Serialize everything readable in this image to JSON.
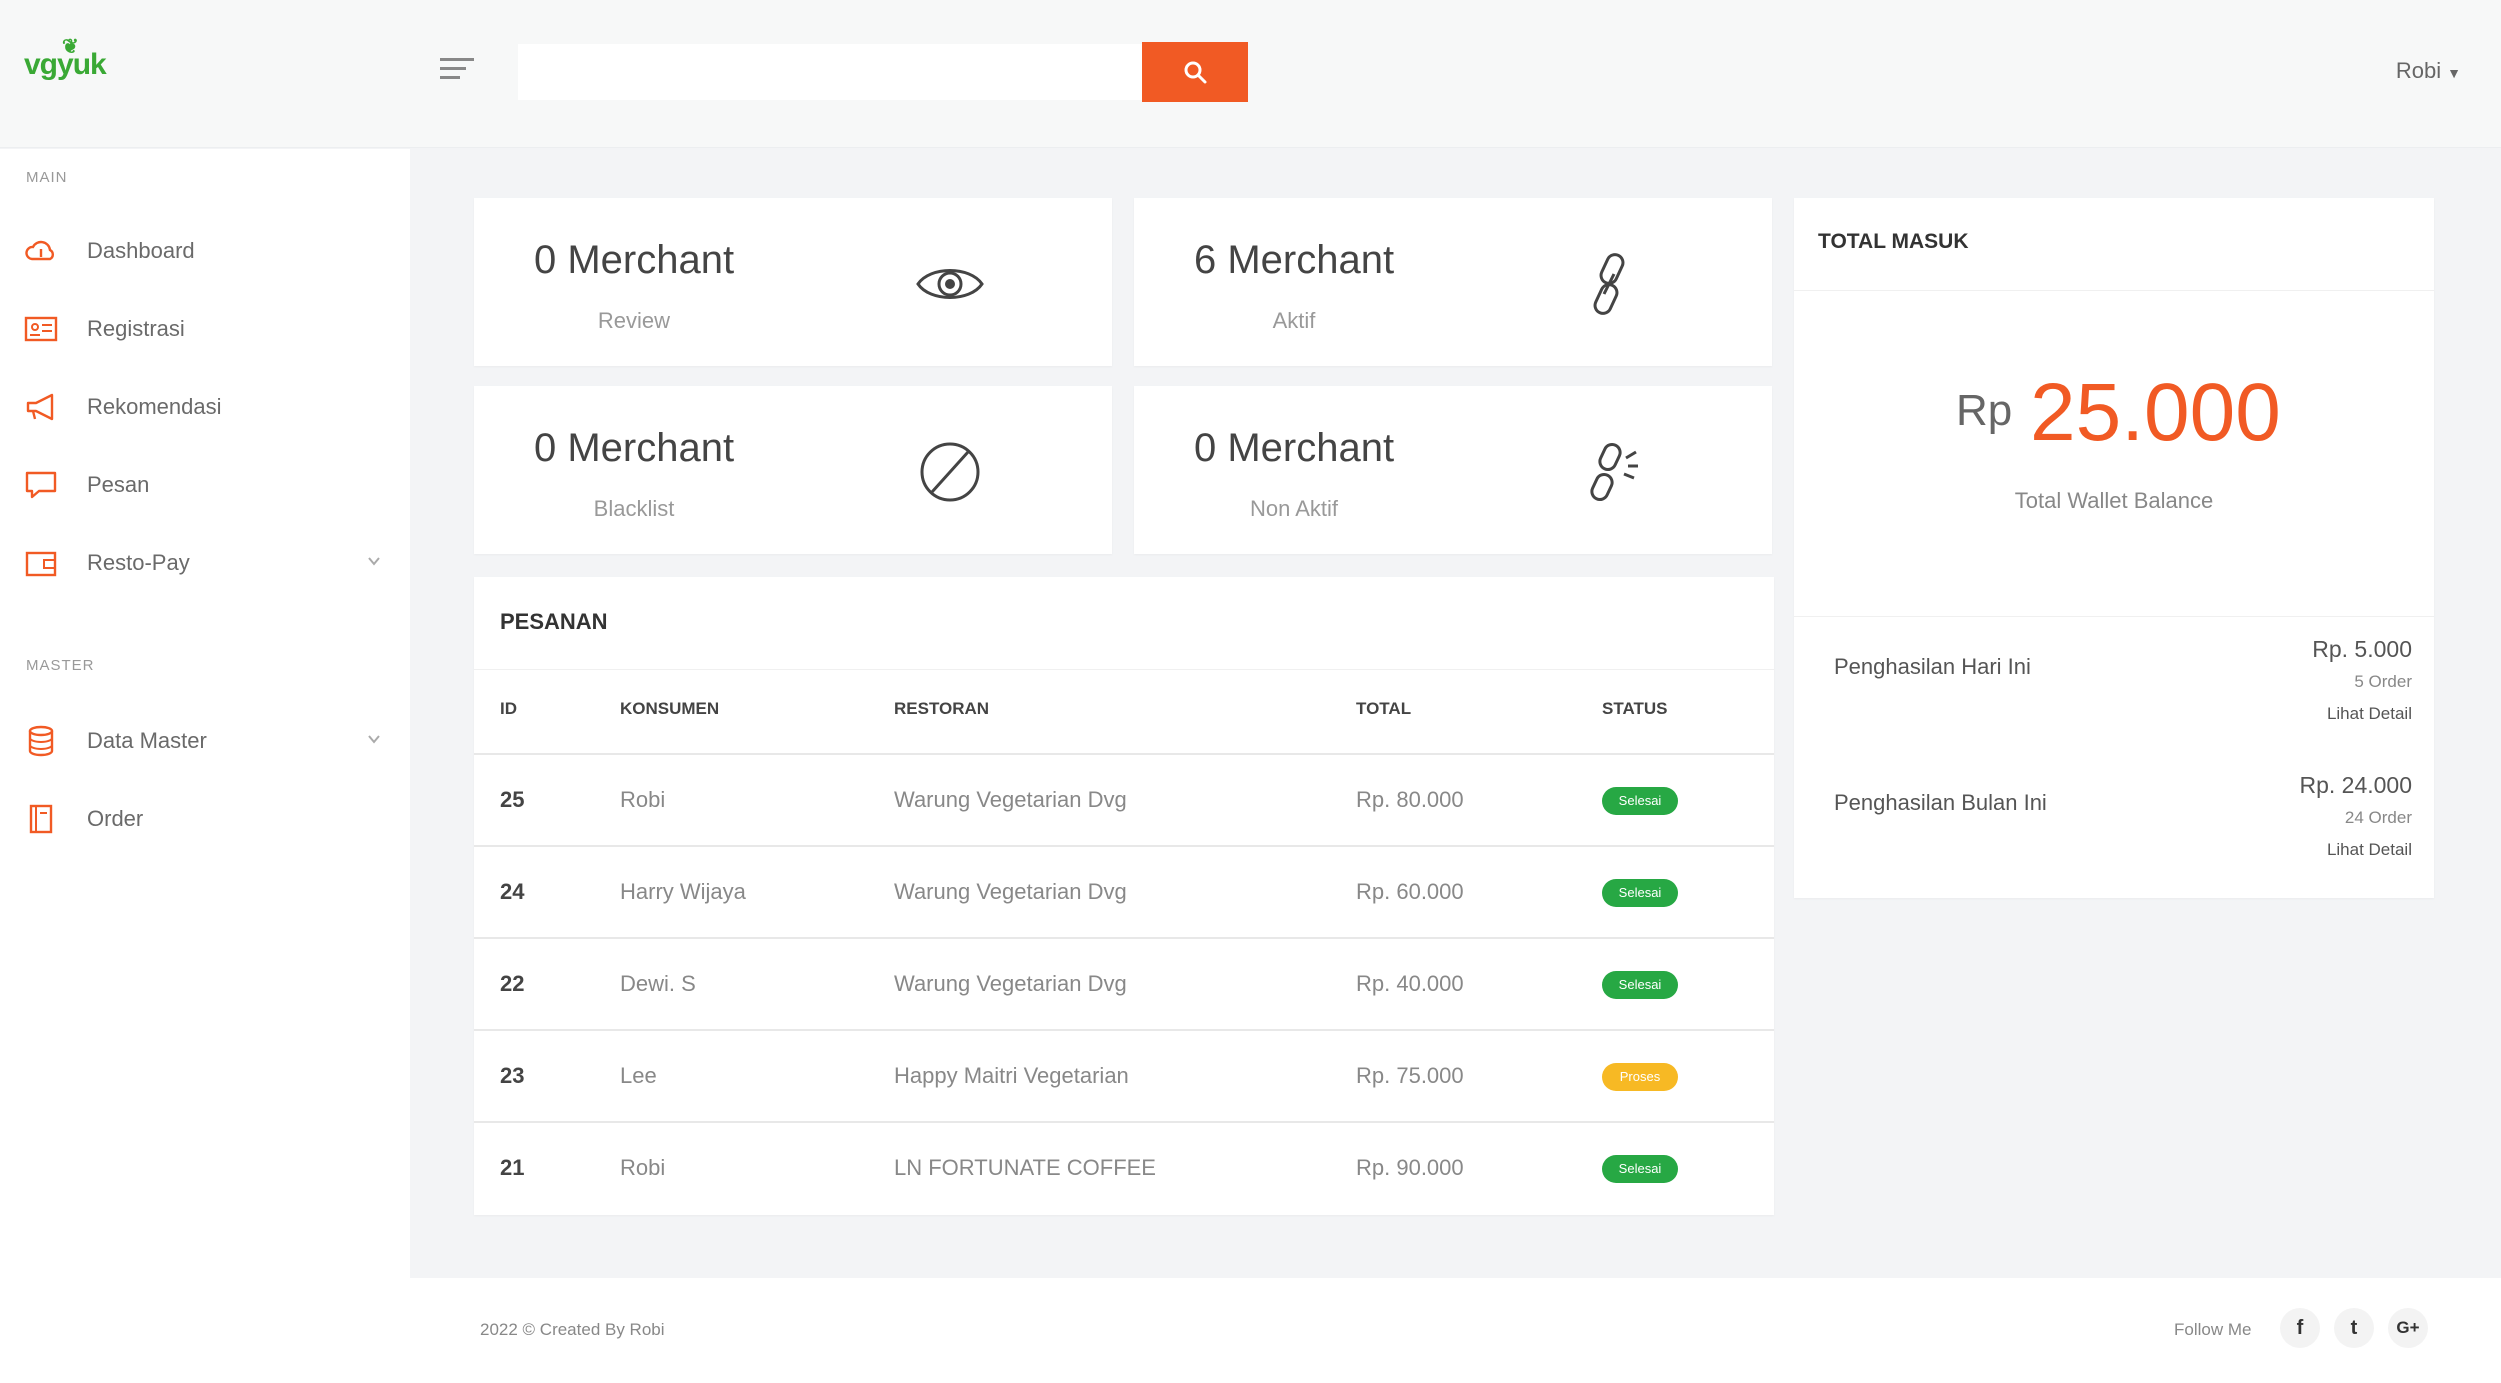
{
  "brand": {
    "logo": "vgyuk",
    "color_primary": "#f15a24",
    "color_logo": "#3aa935"
  },
  "header": {
    "search_placeholder": "",
    "user_name": "Robi"
  },
  "sidebar": {
    "sections": [
      {
        "title": "MAIN",
        "items": [
          {
            "label": "Dashboard",
            "icon": "cloud-icon"
          },
          {
            "label": "Registrasi",
            "icon": "id-card-icon"
          },
          {
            "label": "Rekomendasi",
            "icon": "megaphone-icon"
          },
          {
            "label": "Pesan",
            "icon": "chat-icon"
          },
          {
            "label": "Resto-Pay",
            "icon": "wallet-icon",
            "has_submenu": true
          }
        ]
      },
      {
        "title": "MASTER",
        "items": [
          {
            "label": "Data Master",
            "icon": "database-icon",
            "has_submenu": true
          },
          {
            "label": "Order",
            "icon": "document-icon"
          }
        ]
      }
    ]
  },
  "stats": [
    {
      "value": "0 Merchant",
      "label": "Review",
      "icon": "eye-icon"
    },
    {
      "value": "6 Merchant",
      "label": "Aktif",
      "icon": "link-icon"
    },
    {
      "value": "0 Merchant",
      "label": "Blacklist",
      "icon": "ban-icon"
    },
    {
      "value": "0 Merchant",
      "label": "Non Aktif",
      "icon": "broken-link-icon"
    }
  ],
  "orders": {
    "title": "PESANAN",
    "columns": [
      "ID",
      "KONSUMEN",
      "RESTORAN",
      "TOTAL",
      "STATUS"
    ],
    "rows": [
      {
        "id": "25",
        "konsumen": "Robi",
        "restoran": "Warung Vegetarian Dvg",
        "total": "Rp. 80.000",
        "status": "Selesai",
        "status_color": "#27a844"
      },
      {
        "id": "24",
        "konsumen": "Harry Wijaya",
        "restoran": "Warung Vegetarian Dvg",
        "total": "Rp. 60.000",
        "status": "Selesai",
        "status_color": "#27a844"
      },
      {
        "id": "22",
        "konsumen": "Dewi. S",
        "restoran": "Warung Vegetarian Dvg",
        "total": "Rp. 40.000",
        "status": "Selesai",
        "status_color": "#27a844"
      },
      {
        "id": "23",
        "konsumen": "Lee",
        "restoran": "Happy Maitri Vegetarian",
        "total": "Rp. 75.000",
        "status": "Proses",
        "status_color": "#f7b924"
      },
      {
        "id": "21",
        "konsumen": "Robi",
        "restoran": "LN FORTUNATE COFFEE",
        "total": "Rp. 90.000",
        "status": "Selesai",
        "status_color": "#27a844"
      }
    ]
  },
  "total_masuk": {
    "title": "TOTAL MASUK",
    "currency": "Rp",
    "amount": "25.000",
    "caption": "Total Wallet Balance",
    "incomes": [
      {
        "label": "Penghasilan Hari Ini",
        "amount": "Rp. 5.000",
        "count": "5 Order",
        "link": "Lihat Detail"
      },
      {
        "label": "Penghasilan Bulan Ini",
        "amount": "Rp. 24.000",
        "count": "24 Order",
        "link": "Lihat Detail"
      }
    ]
  },
  "footer": {
    "copyright": "2022 © Created By Robi",
    "follow_label": "Follow Me",
    "social": [
      {
        "glyph": "f",
        "icon": "facebook-icon"
      },
      {
        "glyph": "t",
        "icon": "twitter-icon"
      },
      {
        "glyph": "G+",
        "icon": "google-plus-icon"
      }
    ]
  }
}
